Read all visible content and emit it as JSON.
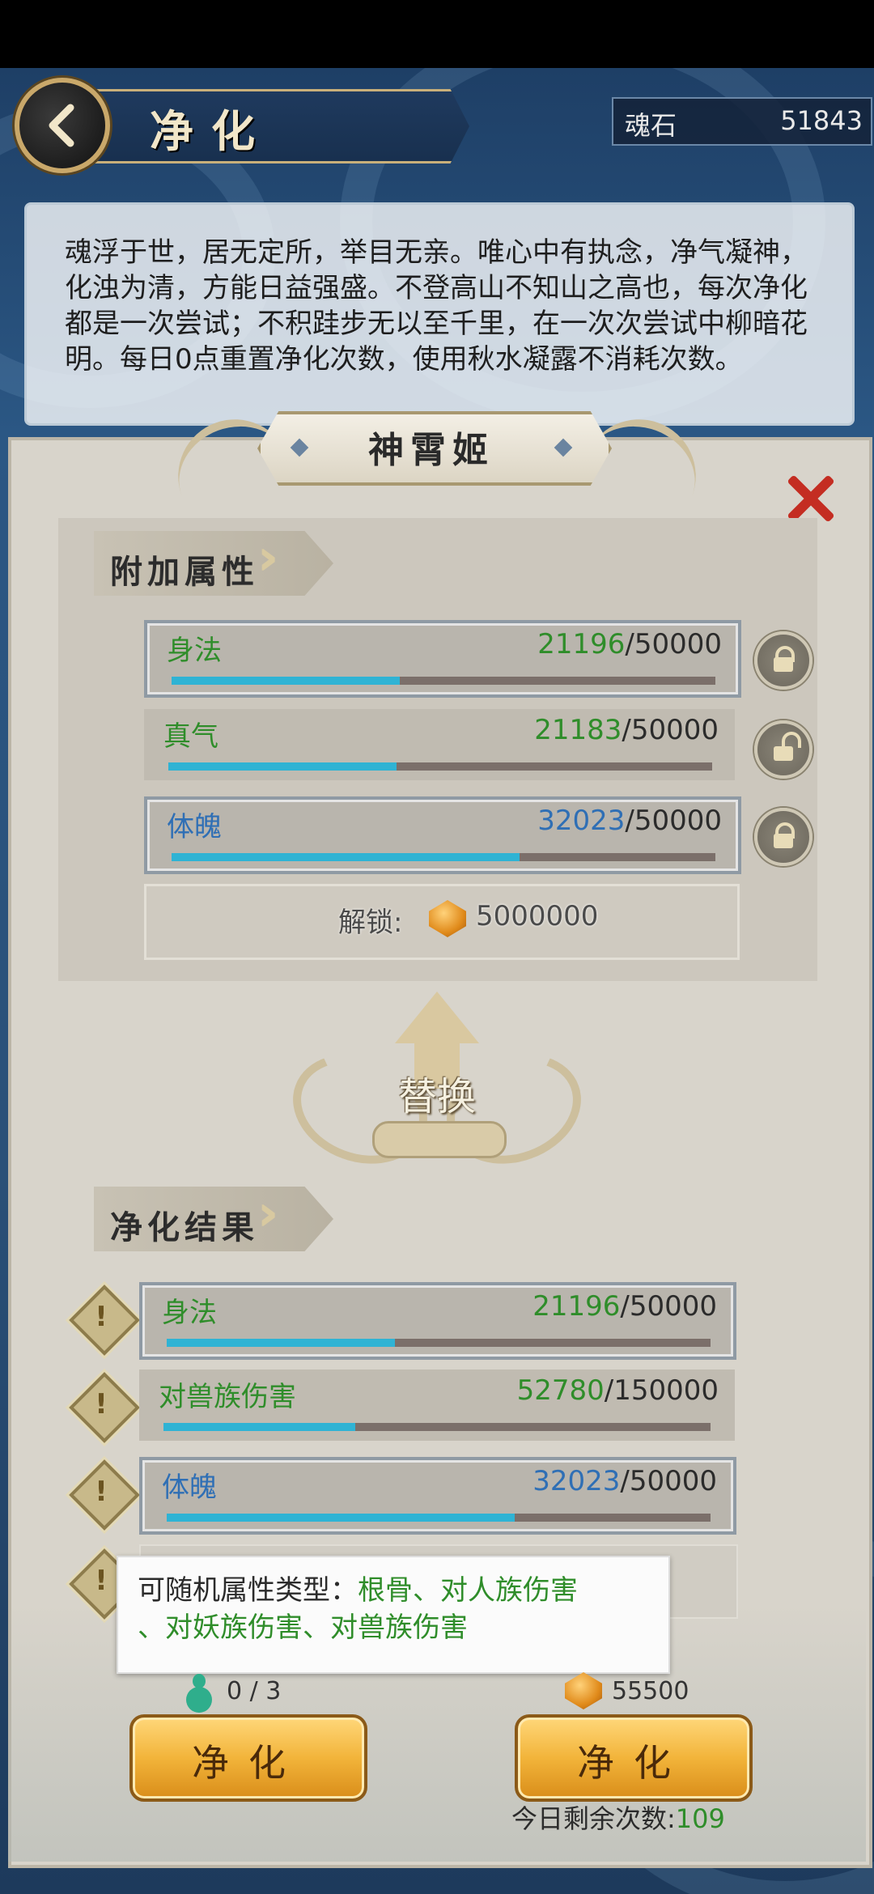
{
  "header": {
    "title": "净化",
    "currency_label": "魂石",
    "currency_value": "51843"
  },
  "description": "魂浮于世，居无定所，举目无亲。唯心中有执念，净气凝神，化浊为清，方能日益强盛。不登高山不知山之高也，每次净化都是一次尝试；不积跬步无以至千里，在一次次尝试中柳暗花明。每日0点重置净化次数，使用秋水凝露不消耗次数。",
  "character_name": "神霄姬",
  "attached": {
    "title": "附加属性",
    "rows": [
      {
        "name": "身法",
        "current": "21196",
        "max": "/50000",
        "fill": 0.42,
        "color": "#2f8d2a",
        "locked": true
      },
      {
        "name": "真气",
        "current": "21183",
        "max": "/50000",
        "fill": 0.42,
        "color": "#2f8d2a",
        "locked": false
      },
      {
        "name": "体魄",
        "current": "32023",
        "max": "/50000",
        "fill": 0.64,
        "color": "#2f6fb5",
        "locked": true
      }
    ],
    "unlock_label": "解锁:",
    "unlock_cost": "5000000"
  },
  "swap_label": "替换",
  "result": {
    "title": "净化结果",
    "rows": [
      {
        "name": "身法",
        "current": "21196",
        "max": "/50000",
        "fill": 0.42,
        "color": "#2f8d2a"
      },
      {
        "name": "对兽族伤害",
        "current": "52780",
        "max": "/150000",
        "fill": 0.35,
        "color": "#2f8d2a"
      },
      {
        "name": "体魄",
        "current": "32023",
        "max": "/50000",
        "fill": 0.64,
        "color": "#2f6fb5"
      }
    ]
  },
  "tooltip": {
    "prefix": "可随机属性类型：",
    "list_part1": "根骨、对人族伤害",
    "list_part2": "、对妖族伤害、对兽族伤害"
  },
  "bottom": {
    "item_count": "0 / 3",
    "gem_cost": "55500",
    "left_button": "净化",
    "right_button": "净化",
    "remaining_label": "今日剩余次数:",
    "remaining_value": "109"
  }
}
